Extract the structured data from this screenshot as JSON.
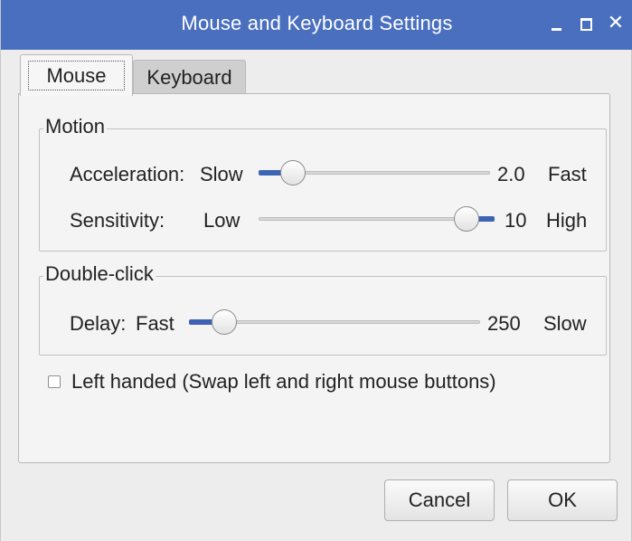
{
  "window": {
    "title": "Mouse and Keyboard Settings",
    "controls": {
      "minimize_icon": "minimize-icon",
      "maximize_icon": "maximize-icon",
      "close_glyph": "✕"
    }
  },
  "tabs": [
    {
      "label": "Mouse",
      "active": true
    },
    {
      "label": "Keyboard",
      "active": false
    }
  ],
  "motion": {
    "legend": "Motion",
    "acceleration": {
      "label": "Acceleration:",
      "min_label": "Slow",
      "value": "2.0",
      "max_label": "Fast",
      "fraction": 0.15
    },
    "sensitivity": {
      "label": "Sensitivity:",
      "min_label": "Low",
      "value": "10",
      "max_label": "High",
      "fraction": 0.88
    }
  },
  "double_click": {
    "legend": "Double-click",
    "delay": {
      "label": "Delay:",
      "min_label": "Fast",
      "value": "250",
      "max_label": "Slow",
      "fraction": 0.12
    }
  },
  "left_handed": {
    "label": "Left handed (Swap left and right mouse buttons)",
    "checked": false
  },
  "buttons": {
    "cancel": "Cancel",
    "ok": "OK"
  },
  "colors": {
    "titlebar": "#4a6fbf",
    "slider_fill": "#3d64b4"
  }
}
